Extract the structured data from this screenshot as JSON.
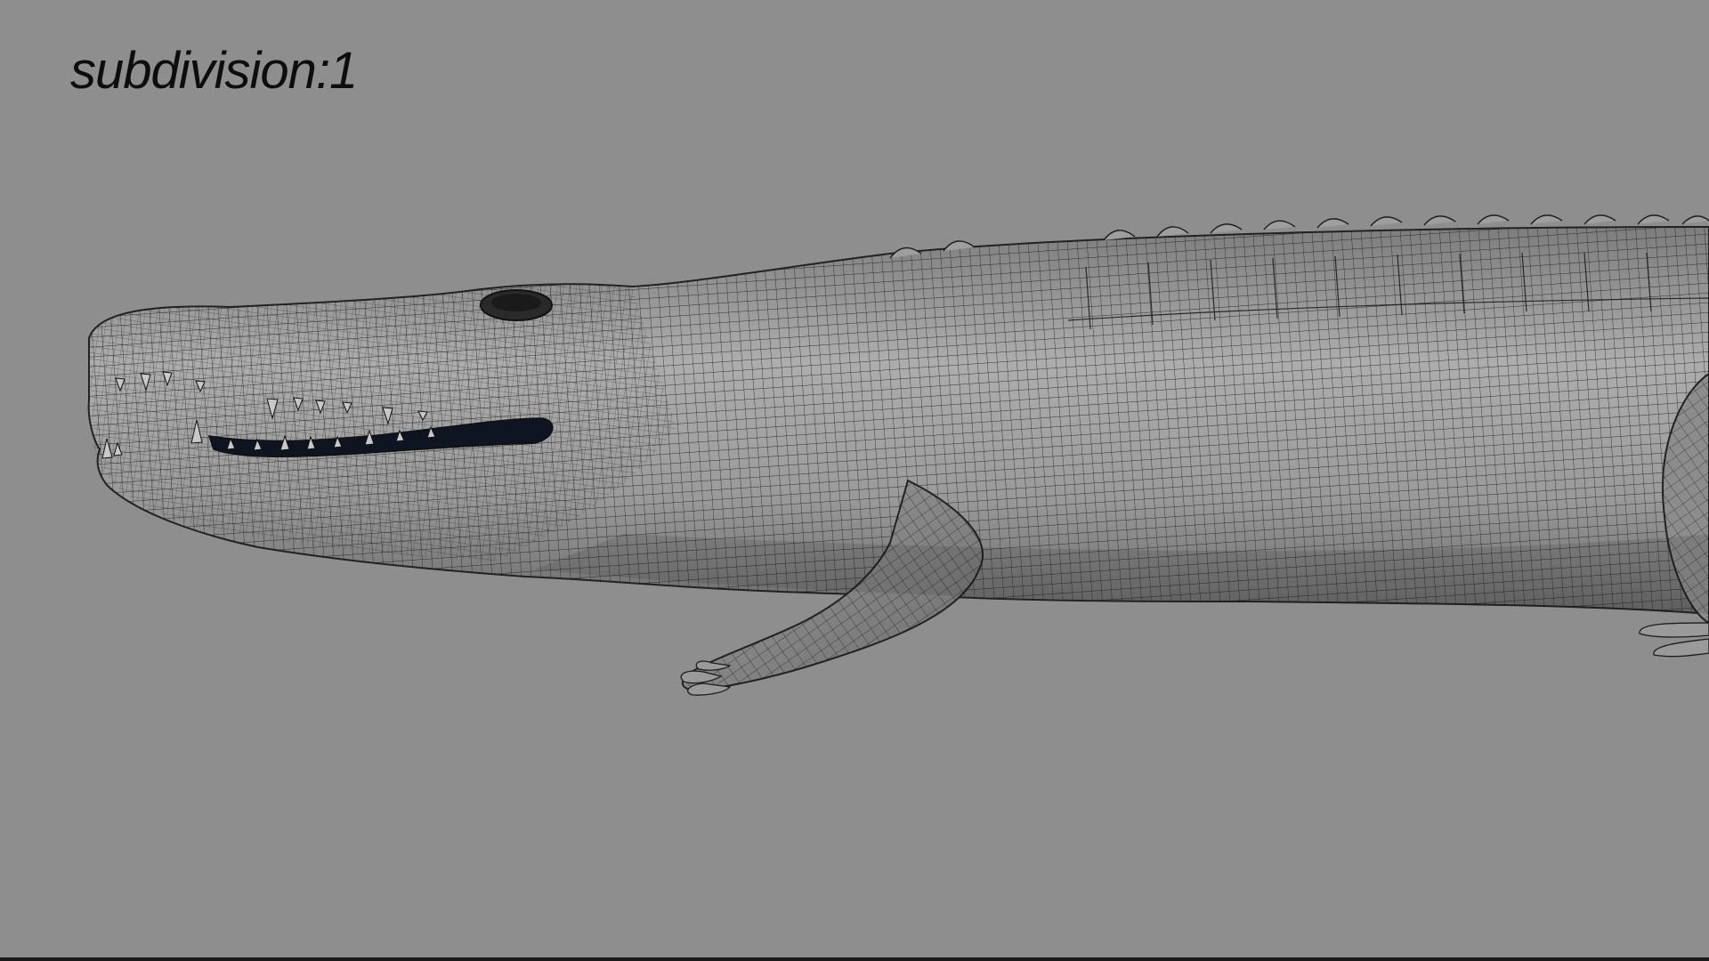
{
  "viewport": {
    "overlay_label": "subdivision:1",
    "background_color": "#8e8e8e",
    "mesh_color": "#1c1c1c",
    "skin_light": "#a9a9a9",
    "skin_dark": "#5a5a5a",
    "mouth_color": "#0e1520"
  },
  "model": {
    "subject": "crocodile",
    "display": "wireframe-on-shaded"
  }
}
